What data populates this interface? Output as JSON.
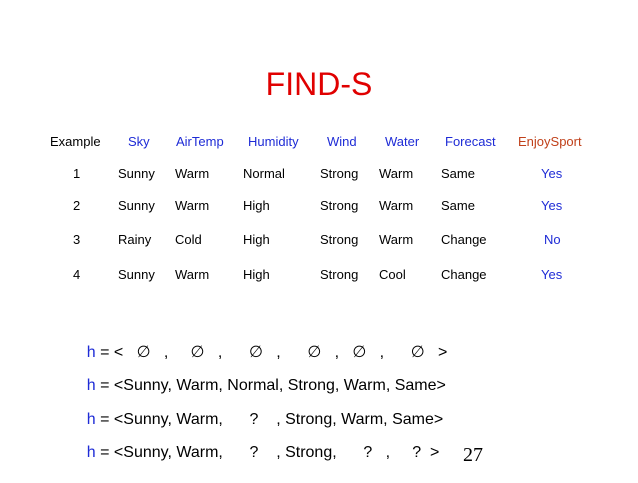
{
  "slide": {
    "title": "FIND-S",
    "page_number": "27"
  },
  "table": {
    "headers": [
      "Example",
      "Sky",
      "AirTemp",
      "Humidity",
      "Wind",
      "Water",
      "Forecast",
      "EnjoySport"
    ],
    "rows": [
      [
        "1",
        "Sunny",
        "Warm",
        "Normal",
        "Strong",
        "Warm",
        "Same",
        "Yes"
      ],
      [
        "2",
        "Sunny",
        "Warm",
        "High",
        "Strong",
        "Warm",
        "Same",
        "Yes"
      ],
      [
        "3",
        "Rainy",
        "Cold",
        "High",
        "Strong",
        "Warm",
        "Change",
        "No"
      ],
      [
        "4",
        "Sunny",
        "Warm",
        "High",
        "Strong",
        "Cool",
        "Change",
        "Yes"
      ]
    ]
  },
  "hypotheses": [
    {
      "var": "h",
      "rest": " = <   ∅   ,     ∅   ,      ∅   ,      ∅   ,   ∅   ,      ∅   >"
    },
    {
      "var": "h",
      "rest": " = <Sunny, Warm, Normal, Strong, Warm, Same>"
    },
    {
      "var": "h",
      "rest": " = <Sunny, Warm,      ?    , Strong, Warm, Same>"
    },
    {
      "var": "h",
      "rest": " = <Sunny, Warm,      ?    , Strong,      ?   ,     ?  >"
    }
  ],
  "colors": {
    "title": "#e00000",
    "header_attributes": "#1e2bd6",
    "header_target": "#c0401a",
    "target_values": "#1e2bd6",
    "hypothesis_var": "#1e2bd6"
  }
}
